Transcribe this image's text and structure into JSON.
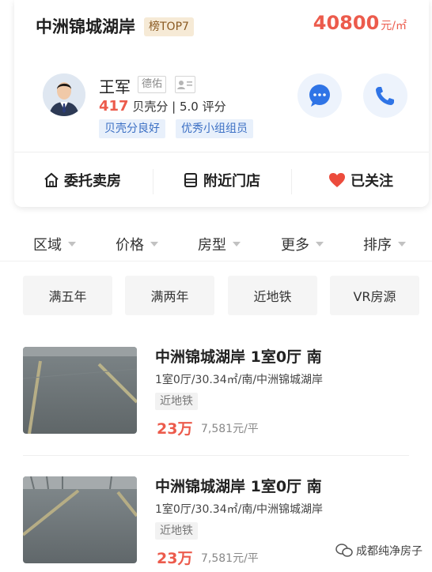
{
  "header": {
    "community": "中洲锦城湖岸",
    "badge": "榜TOP7",
    "price_value": "40800",
    "price_unit": "元/㎡"
  },
  "agent": {
    "name": "王军",
    "company": "德佑",
    "score_value": "417",
    "score_label": "贝壳分",
    "rating": "| 5.0 评分",
    "tags": [
      "贝壳分良好",
      "优秀小组组员"
    ],
    "icons": {
      "message": "chat-bubble-icon",
      "phone": "phone-icon",
      "id": "id-card-icon"
    }
  },
  "actions": [
    {
      "label": "委托卖房",
      "icon": "house-icon"
    },
    {
      "label": "附近门店",
      "icon": "store-icon"
    },
    {
      "label": "已关注",
      "icon": "heart-icon"
    }
  ],
  "filters": [
    "区域",
    "价格",
    "房型",
    "更多",
    "排序"
  ],
  "chips": [
    "满五年",
    "满两年",
    "近地铁",
    "VR房源"
  ],
  "listings": [
    {
      "title": "中洲锦城湖岸 1室0厅 南",
      "desc": "1室0厅/30.34㎡/南/中洲锦城湖岸",
      "tag": "近地铁",
      "price": "23万",
      "unit_price": "7,581元/平"
    },
    {
      "title": "中洲锦城湖岸 1室0厅 南",
      "desc": "1室0厅/30.34㎡/南/中洲锦城湖岸",
      "tag": "近地铁",
      "price": "23万",
      "unit_price": "7,581元/平"
    }
  ],
  "watermark": "成都纯净房子",
  "colors": {
    "accent": "#ec5b4c",
    "blue": "#3b6fc4",
    "heart": "#ec4b3c"
  }
}
